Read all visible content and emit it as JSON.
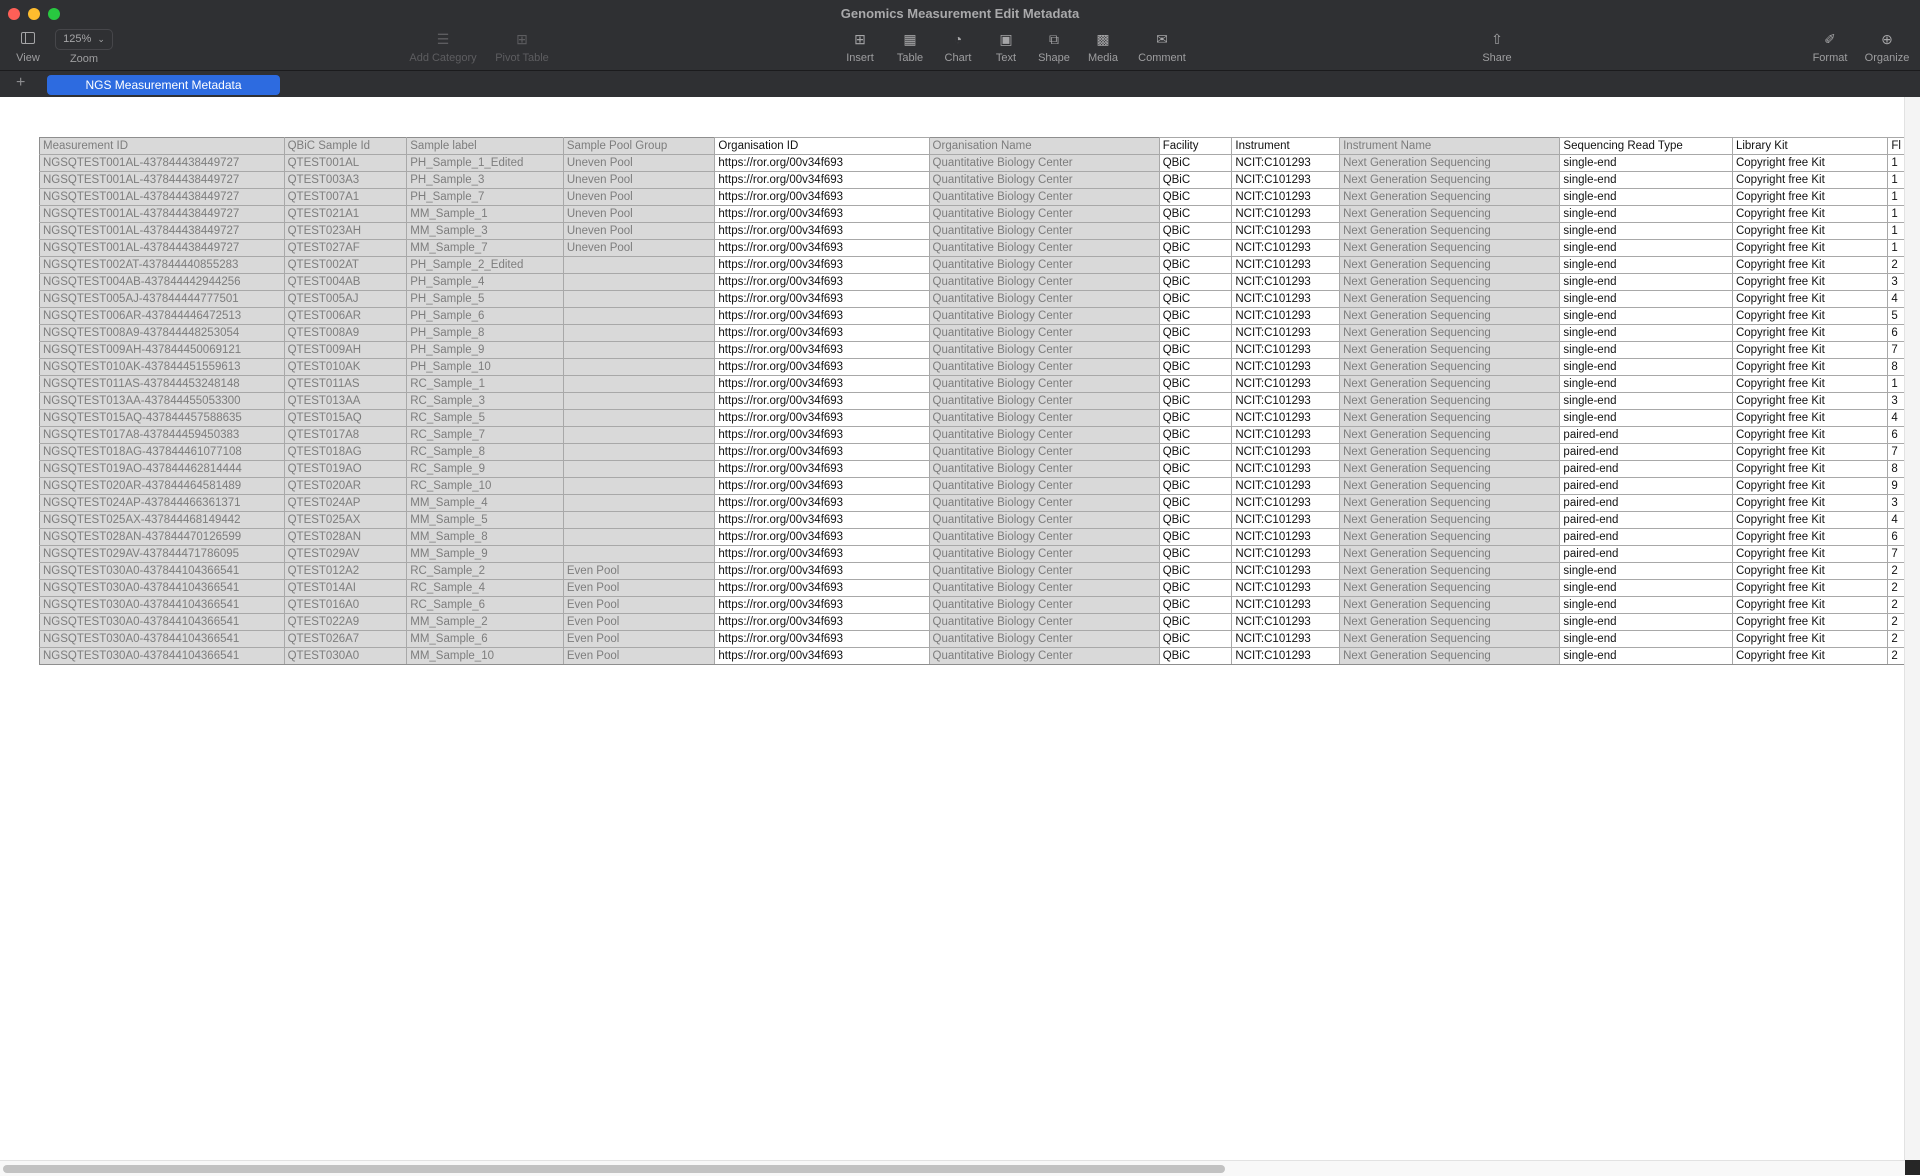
{
  "window": {
    "title": "Genomics Measurement Edit Metadata"
  },
  "toolbar": {
    "view": {
      "label": "View",
      "icon": "sidebar-icon"
    },
    "zoom": {
      "label": "Zoom",
      "value": "125%"
    },
    "add_category": {
      "label": "Add Category",
      "icon": "list-icon"
    },
    "pivot_table": {
      "label": "Pivot Table",
      "icon": "pivot-table-icon"
    },
    "insert": {
      "label": "Insert",
      "icon": "insert-icon"
    },
    "table": {
      "label": "Table",
      "icon": "table-icon"
    },
    "chart": {
      "label": "Chart",
      "icon": "chart-icon"
    },
    "text": {
      "label": "Text",
      "icon": "text-box-icon"
    },
    "shape": {
      "label": "Shape",
      "icon": "shape-icon"
    },
    "media": {
      "label": "Media",
      "icon": "media-icon"
    },
    "comment": {
      "label": "Comment",
      "icon": "comment-icon"
    },
    "share": {
      "label": "Share",
      "icon": "share-icon"
    },
    "format": {
      "label": "Format",
      "icon": "paintbrush-icon"
    },
    "organize": {
      "label": "Organize",
      "icon": "filter-icon"
    }
  },
  "tabs": {
    "add_label": "+",
    "sheets": [
      {
        "label": "NGS Measurement Metadata",
        "active": true
      }
    ]
  },
  "sheet": {
    "columns": [
      {
        "label": "Measurement ID",
        "editable": false
      },
      {
        "label": "QBiC Sample Id",
        "editable": false
      },
      {
        "label": "Sample label",
        "editable": false
      },
      {
        "label": "Sample Pool Group",
        "editable": false
      },
      {
        "label": "Organisation ID",
        "editable": true
      },
      {
        "label": "Organisation Name",
        "editable": false
      },
      {
        "label": "Facility",
        "editable": true
      },
      {
        "label": "Instrument",
        "editable": true
      },
      {
        "label": "Instrument Name",
        "editable": false
      },
      {
        "label": "Sequencing Read Type",
        "editable": true
      },
      {
        "label": "Library Kit",
        "editable": true
      },
      {
        "label": "Fl",
        "editable": true
      }
    ],
    "rows": [
      [
        "NGSQTEST001AL-437844438449727",
        "QTEST001AL",
        "PH_Sample_1_Edited",
        "Uneven Pool",
        "https://ror.org/00v34f693",
        "Quantitative Biology Center",
        "QBiC",
        "NCIT:C101293",
        "Next Generation Sequencing",
        "single-end",
        "Copyright free Kit",
        "1"
      ],
      [
        "NGSQTEST001AL-437844438449727",
        "QTEST003A3",
        "PH_Sample_3",
        "Uneven Pool",
        "https://ror.org/00v34f693",
        "Quantitative Biology Center",
        "QBiC",
        "NCIT:C101293",
        "Next Generation Sequencing",
        "single-end",
        "Copyright free Kit",
        "1"
      ],
      [
        "NGSQTEST001AL-437844438449727",
        "QTEST007A1",
        "PH_Sample_7",
        "Uneven Pool",
        "https://ror.org/00v34f693",
        "Quantitative Biology Center",
        "QBiC",
        "NCIT:C101293",
        "Next Generation Sequencing",
        "single-end",
        "Copyright free Kit",
        "1"
      ],
      [
        "NGSQTEST001AL-437844438449727",
        "QTEST021A1",
        "MM_Sample_1",
        "Uneven Pool",
        "https://ror.org/00v34f693",
        "Quantitative Biology Center",
        "QBiC",
        "NCIT:C101293",
        "Next Generation Sequencing",
        "single-end",
        "Copyright free Kit",
        "1"
      ],
      [
        "NGSQTEST001AL-437844438449727",
        "QTEST023AH",
        "MM_Sample_3",
        "Uneven Pool",
        "https://ror.org/00v34f693",
        "Quantitative Biology Center",
        "QBiC",
        "NCIT:C101293",
        "Next Generation Sequencing",
        "single-end",
        "Copyright free Kit",
        "1"
      ],
      [
        "NGSQTEST001AL-437844438449727",
        "QTEST027AF",
        "MM_Sample_7",
        "Uneven Pool",
        "https://ror.org/00v34f693",
        "Quantitative Biology Center",
        "QBiC",
        "NCIT:C101293",
        "Next Generation Sequencing",
        "single-end",
        "Copyright free Kit",
        "1"
      ],
      [
        "NGSQTEST002AT-437844440855283",
        "QTEST002AT",
        "PH_Sample_2_Edited",
        "",
        "https://ror.org/00v34f693",
        "Quantitative Biology Center",
        "QBiC",
        "NCIT:C101293",
        "Next Generation Sequencing",
        "single-end",
        "Copyright free Kit",
        "2"
      ],
      [
        "NGSQTEST004AB-437844442944256",
        "QTEST004AB",
        "PH_Sample_4",
        "",
        "https://ror.org/00v34f693",
        "Quantitative Biology Center",
        "QBiC",
        "NCIT:C101293",
        "Next Generation Sequencing",
        "single-end",
        "Copyright free Kit",
        "3"
      ],
      [
        "NGSQTEST005AJ-437844444777501",
        "QTEST005AJ",
        "PH_Sample_5",
        "",
        "https://ror.org/00v34f693",
        "Quantitative Biology Center",
        "QBiC",
        "NCIT:C101293",
        "Next Generation Sequencing",
        "single-end",
        "Copyright free Kit",
        "4"
      ],
      [
        "NGSQTEST006AR-437844446472513",
        "QTEST006AR",
        "PH_Sample_6",
        "",
        "https://ror.org/00v34f693",
        "Quantitative Biology Center",
        "QBiC",
        "NCIT:C101293",
        "Next Generation Sequencing",
        "single-end",
        "Copyright free Kit",
        "5"
      ],
      [
        "NGSQTEST008A9-437844448253054",
        "QTEST008A9",
        "PH_Sample_8",
        "",
        "https://ror.org/00v34f693",
        "Quantitative Biology Center",
        "QBiC",
        "NCIT:C101293",
        "Next Generation Sequencing",
        "single-end",
        "Copyright free Kit",
        "6"
      ],
      [
        "NGSQTEST009AH-437844450069121",
        "QTEST009AH",
        "PH_Sample_9",
        "",
        "https://ror.org/00v34f693",
        "Quantitative Biology Center",
        "QBiC",
        "NCIT:C101293",
        "Next Generation Sequencing",
        "single-end",
        "Copyright free Kit",
        "7"
      ],
      [
        "NGSQTEST010AK-437844451559613",
        "QTEST010AK",
        "PH_Sample_10",
        "",
        "https://ror.org/00v34f693",
        "Quantitative Biology Center",
        "QBiC",
        "NCIT:C101293",
        "Next Generation Sequencing",
        "single-end",
        "Copyright free Kit",
        "8"
      ],
      [
        "NGSQTEST011AS-437844453248148",
        "QTEST011AS",
        "RC_Sample_1",
        "",
        "https://ror.org/00v34f693",
        "Quantitative Biology Center",
        "QBiC",
        "NCIT:C101293",
        "Next Generation Sequencing",
        "single-end",
        "Copyright free Kit",
        "1"
      ],
      [
        "NGSQTEST013AA-437844455053300",
        "QTEST013AA",
        "RC_Sample_3",
        "",
        "https://ror.org/00v34f693",
        "Quantitative Biology Center",
        "QBiC",
        "NCIT:C101293",
        "Next Generation Sequencing",
        "single-end",
        "Copyright free Kit",
        "3"
      ],
      [
        "NGSQTEST015AQ-437844457588635",
        "QTEST015AQ",
        "RC_Sample_5",
        "",
        "https://ror.org/00v34f693",
        "Quantitative Biology Center",
        "QBiC",
        "NCIT:C101293",
        "Next Generation Sequencing",
        "single-end",
        "Copyright free Kit",
        "4"
      ],
      [
        "NGSQTEST017A8-437844459450383",
        "QTEST017A8",
        "RC_Sample_7",
        "",
        "https://ror.org/00v34f693",
        "Quantitative Biology Center",
        "QBiC",
        "NCIT:C101293",
        "Next Generation Sequencing",
        "paired-end",
        "Copyright free Kit",
        "6"
      ],
      [
        "NGSQTEST018AG-437844461077108",
        "QTEST018AG",
        "RC_Sample_8",
        "",
        "https://ror.org/00v34f693",
        "Quantitative Biology Center",
        "QBiC",
        "NCIT:C101293",
        "Next Generation Sequencing",
        "paired-end",
        "Copyright free Kit",
        "7"
      ],
      [
        "NGSQTEST019AO-437844462814444",
        "QTEST019AO",
        "RC_Sample_9",
        "",
        "https://ror.org/00v34f693",
        "Quantitative Biology Center",
        "QBiC",
        "NCIT:C101293",
        "Next Generation Sequencing",
        "paired-end",
        "Copyright free Kit",
        "8"
      ],
      [
        "NGSQTEST020AR-437844464581489",
        "QTEST020AR",
        "RC_Sample_10",
        "",
        "https://ror.org/00v34f693",
        "Quantitative Biology Center",
        "QBiC",
        "NCIT:C101293",
        "Next Generation Sequencing",
        "paired-end",
        "Copyright free Kit",
        "9"
      ],
      [
        "NGSQTEST024AP-437844466361371",
        "QTEST024AP",
        "MM_Sample_4",
        "",
        "https://ror.org/00v34f693",
        "Quantitative Biology Center",
        "QBiC",
        "NCIT:C101293",
        "Next Generation Sequencing",
        "paired-end",
        "Copyright free Kit",
        "3"
      ],
      [
        "NGSQTEST025AX-437844468149442",
        "QTEST025AX",
        "MM_Sample_5",
        "",
        "https://ror.org/00v34f693",
        "Quantitative Biology Center",
        "QBiC",
        "NCIT:C101293",
        "Next Generation Sequencing",
        "paired-end",
        "Copyright free Kit",
        "4"
      ],
      [
        "NGSQTEST028AN-437844470126599",
        "QTEST028AN",
        "MM_Sample_8",
        "",
        "https://ror.org/00v34f693",
        "Quantitative Biology Center",
        "QBiC",
        "NCIT:C101293",
        "Next Generation Sequencing",
        "paired-end",
        "Copyright free Kit",
        "6"
      ],
      [
        "NGSQTEST029AV-437844471786095",
        "QTEST029AV",
        "MM_Sample_9",
        "",
        "https://ror.org/00v34f693",
        "Quantitative Biology Center",
        "QBiC",
        "NCIT:C101293",
        "Next Generation Sequencing",
        "paired-end",
        "Copyright free Kit",
        "7"
      ],
      [
        "NGSQTEST030A0-437844104366541",
        "QTEST012A2",
        "RC_Sample_2",
        "Even Pool",
        "https://ror.org/00v34f693",
        "Quantitative Biology Center",
        "QBiC",
        "NCIT:C101293",
        "Next Generation Sequencing",
        "single-end",
        "Copyright free Kit",
        "2"
      ],
      [
        "NGSQTEST030A0-437844104366541",
        "QTEST014AI",
        "RC_Sample_4",
        "Even Pool",
        "https://ror.org/00v34f693",
        "Quantitative Biology Center",
        "QBiC",
        "NCIT:C101293",
        "Next Generation Sequencing",
        "single-end",
        "Copyright free Kit",
        "2"
      ],
      [
        "NGSQTEST030A0-437844104366541",
        "QTEST016A0",
        "RC_Sample_6",
        "Even Pool",
        "https://ror.org/00v34f693",
        "Quantitative Biology Center",
        "QBiC",
        "NCIT:C101293",
        "Next Generation Sequencing",
        "single-end",
        "Copyright free Kit",
        "2"
      ],
      [
        "NGSQTEST030A0-437844104366541",
        "QTEST022A9",
        "MM_Sample_2",
        "Even Pool",
        "https://ror.org/00v34f693",
        "Quantitative Biology Center",
        "QBiC",
        "NCIT:C101293",
        "Next Generation Sequencing",
        "single-end",
        "Copyright free Kit",
        "2"
      ],
      [
        "NGSQTEST030A0-437844104366541",
        "QTEST026A7",
        "MM_Sample_6",
        "Even Pool",
        "https://ror.org/00v34f693",
        "Quantitative Biology Center",
        "QBiC",
        "NCIT:C101293",
        "Next Generation Sequencing",
        "single-end",
        "Copyright free Kit",
        "2"
      ],
      [
        "NGSQTEST030A0-437844104366541",
        "QTEST030A0",
        "MM_Sample_10",
        "Even Pool",
        "https://ror.org/00v34f693",
        "Quantitative Biology Center",
        "QBiC",
        "NCIT:C101293",
        "Next Generation Sequencing",
        "single-end",
        "Copyright free Kit",
        "2"
      ]
    ]
  },
  "colors": {
    "titlebar_bg": "#2f3033",
    "active_tab": "#2d6be0",
    "readonly_cell": "#d9d9d9",
    "readonly_text": "#7d7d7d",
    "editable_text": "#111111"
  }
}
